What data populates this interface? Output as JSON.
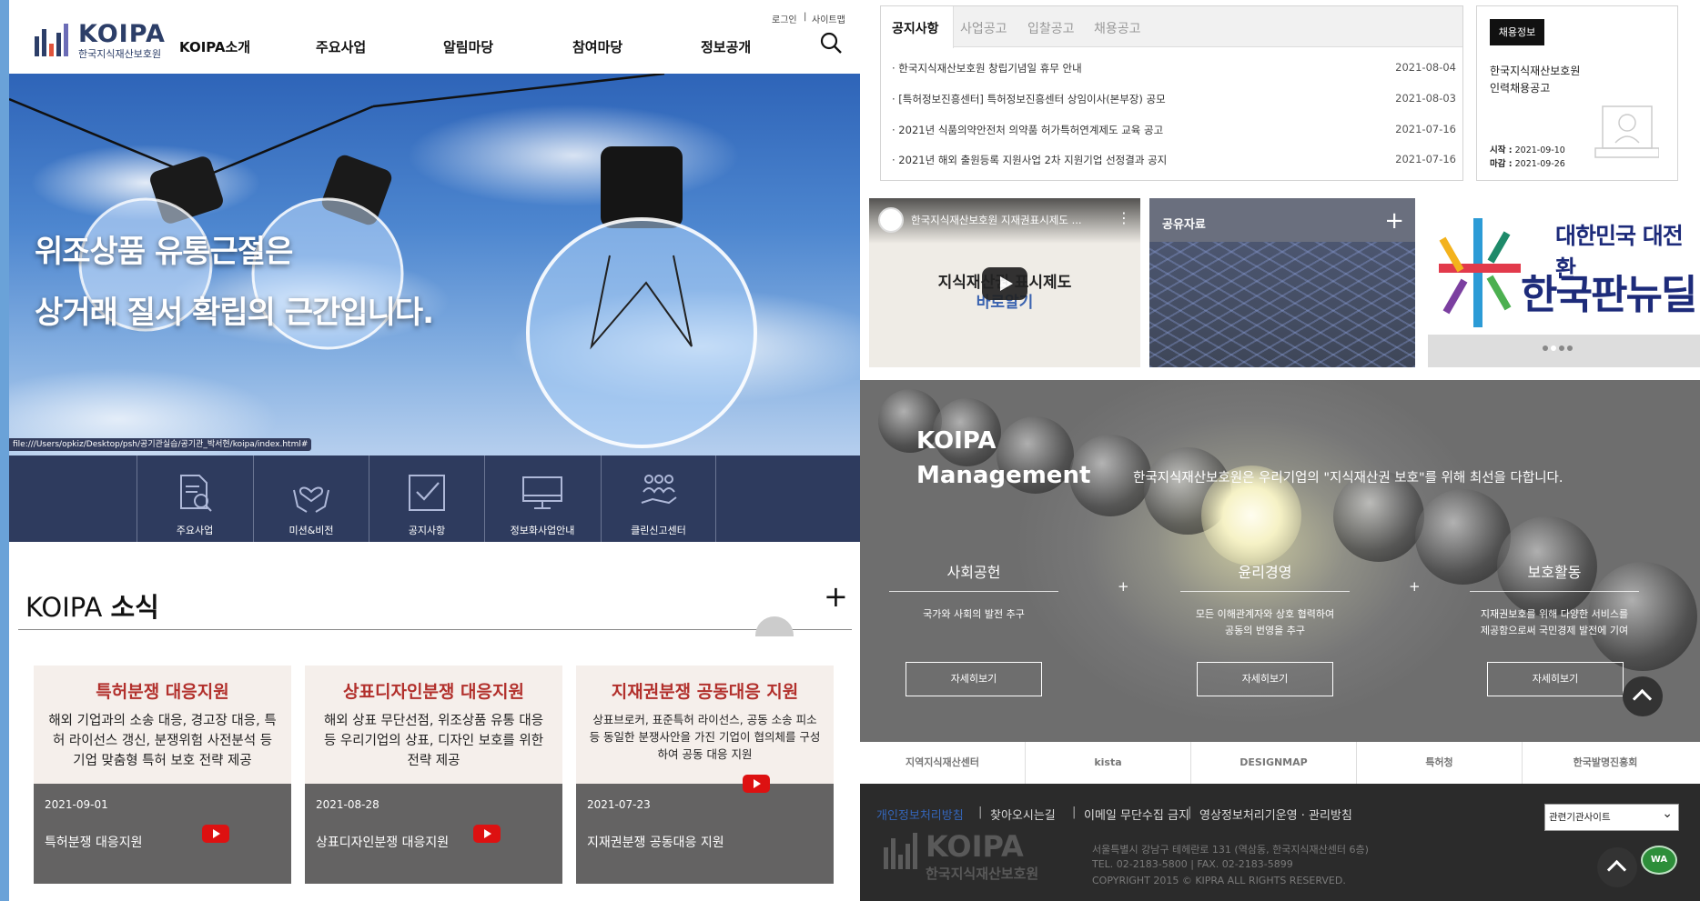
{
  "header": {
    "logo_title": "KOIPA",
    "logo_subtitle": "한국지식재산보호원",
    "nav": [
      "KOIPA소개",
      "주요사업",
      "알림마당",
      "참여마당",
      "정보공개"
    ],
    "util": [
      "로그인",
      "사이트맵"
    ],
    "util_sep": "|"
  },
  "hero": {
    "line1": "위조상품 유통근절은",
    "line2": "상거래 질서 확립의 근간입니다.",
    "status_url": "file:///Users/opkiz/Desktop/psh/공기관실습/공기관_박서현/koipa/index.html#"
  },
  "quick_menu": [
    "주요사업",
    "미션&비전",
    "공지사항",
    "정보화사업안내",
    "클린신고센터"
  ],
  "news": {
    "title_plain": "KOIPA ",
    "title_bold": "소식",
    "more": "+",
    "cards": [
      {
        "heading": "특허분쟁 대응지원",
        "body": "해외 기업과의 소송 대응, 경고장 대응, 특허 라이선스 갱신, 분쟁위험 사전분석 등 기업 맞춤형 특허 보호 전략 제공",
        "date": "2021-09-01",
        "name": "특허분쟁 대응지원"
      },
      {
        "heading": "상표디자인분쟁 대응지원",
        "body": "해외 상표 무단선점, 위조상품 유통 대응 등 우리기업의 상표, 디자인 보호를 위한 전략 제공",
        "date": "2021-08-28",
        "name": "상표디자인분쟁 대응지원"
      },
      {
        "heading": "지재권분쟁 공동대응 지원",
        "body": "상표브로커, 표준특허 라이선스, 공동 소송 피소 등 동일한 분쟁사안을 가진 기업이 협의체를 구성하여 공동 대응 지원",
        "date": "2021-07-23",
        "name": "지재권분쟁 공동대응 지원"
      }
    ]
  },
  "notice": {
    "tabs": [
      "공지사항",
      "사업공고",
      "입찰공고",
      "채용공고"
    ],
    "items": [
      {
        "title": "· 한국지식재산보호원 창립기념일 휴무 안내",
        "date": "2021-08-04"
      },
      {
        "title": "· [특허정보진흥센터] 특허정보진흥센터 상임이사(본부장) 공모",
        "date": "2021-08-03"
      },
      {
        "title": "· 2021년 식품의약안전처 의약품 허가특허연계제도 교육 공고",
        "date": "2021-07-16"
      },
      {
        "title": "· 2021년 해외 출원등록 지원사업 2차 지원기업 선정결과 공지",
        "date": "2021-07-16"
      }
    ]
  },
  "recruit": {
    "badge": "채용정보",
    "title1": "한국지식재산보호원",
    "title2": "인력채용공고",
    "start_label": "시작 :",
    "start": "2021-09-10",
    "end_label": "마감 :",
    "end": "2021-09-26"
  },
  "video": {
    "title": "한국지식재산보호원 지재권표시제도 ...",
    "main1": "지식재산권 표시제도",
    "main2": "바로알기"
  },
  "share": {
    "title": "공유자료",
    "plus": "+"
  },
  "banner": {
    "line1": "대한민국 대전환",
    "line2": "한국판뉴딜"
  },
  "management": {
    "title1": "KOIPA",
    "title2": "Management",
    "desc": "한국지식재산보호원은 우리기업의 \"지식재산권 보호\"를 위해 최선을 다합니다.",
    "cols": [
      {
        "h": "사회공헌",
        "t1": "국가와 사회의 발전 추구",
        "t2": "",
        "btn": "자세히보기"
      },
      {
        "h": "윤리경영",
        "t1": "모든 이해관계자와 상호 협력하여",
        "t2": "공동의 번영을 추구",
        "btn": "자세히보기"
      },
      {
        "h": "보호활동",
        "t1": "지재권보호를 위해 다양한 서비스를",
        "t2": "제공함으로써 국민경제 발전에 기여",
        "btn": "자세히보기"
      }
    ]
  },
  "partners": [
    "지역지식재산센터",
    "kista",
    "DESIGNMAP",
    "특허청",
    "한국발명진흥회"
  ],
  "footer": {
    "links": [
      "개인정보처리방침",
      "찾아오시는길",
      "이메일 무단수집 금지",
      "영상정보처리기운영 · 관리방침"
    ],
    "sep": "|",
    "logo_title": "KOIPA",
    "logo_sub": "한국지식재산보호원",
    "addr1": "서울특별시 강남구 테헤란로 131 (역삼동, 한국지식재산센터 6층)",
    "addr2": "TEL. 02-2183-5800 | FAX. 02-2183-5899",
    "addr3": "COPYRIGHT 2015 © KIPRA ALL RIGHTS RESERVED.",
    "select_label": "관련기관사이트",
    "badge": "WA"
  },
  "colors": {
    "navy": "#2e3b5e",
    "accent_red": "#b2302c",
    "footer_bg": "#2b2b2b"
  }
}
